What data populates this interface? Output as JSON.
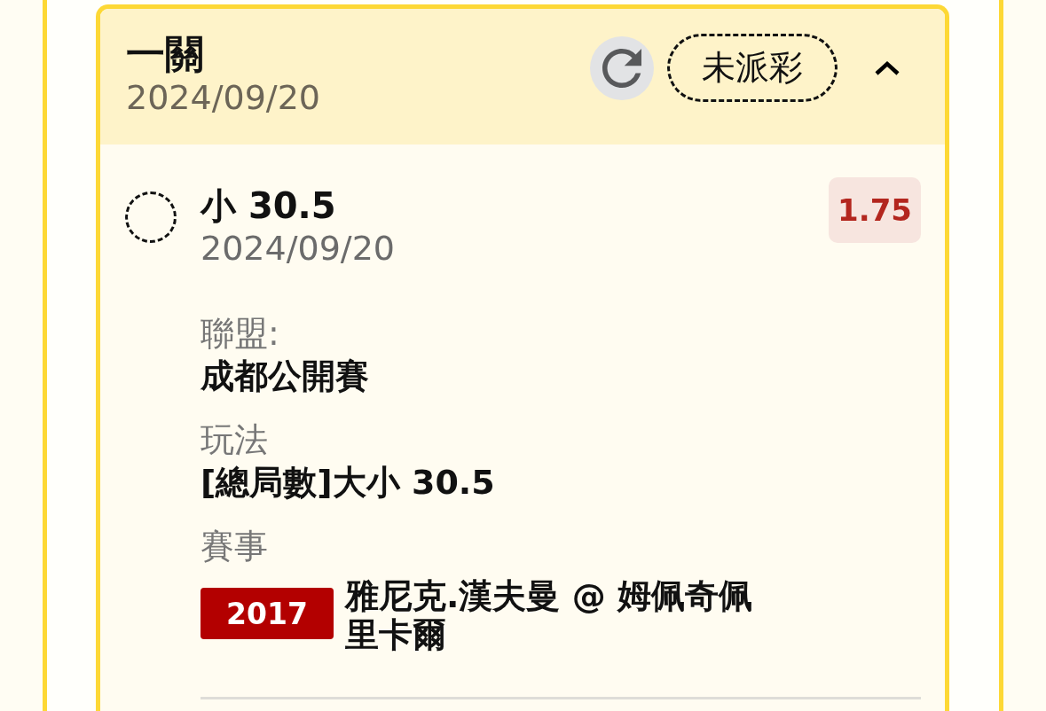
{
  "bet": {
    "title": "一關",
    "date": "2024/09/20",
    "status": "未派彩",
    "expanded": true,
    "selection": {
      "settled": false,
      "name": "小 30.5",
      "date": "2024/09/20",
      "odds": "1.75"
    },
    "details": [
      {
        "kind": "text",
        "label": "聯盟:",
        "value": "成都公開賽"
      },
      {
        "kind": "text",
        "label": "玩法",
        "value": "[總局數]大小 30.5"
      },
      {
        "kind": "match",
        "label": "賽事",
        "code": "2017",
        "value": "雅尼克.漢夫曼 @ 姆佩奇佩里卡爾"
      }
    ]
  }
}
